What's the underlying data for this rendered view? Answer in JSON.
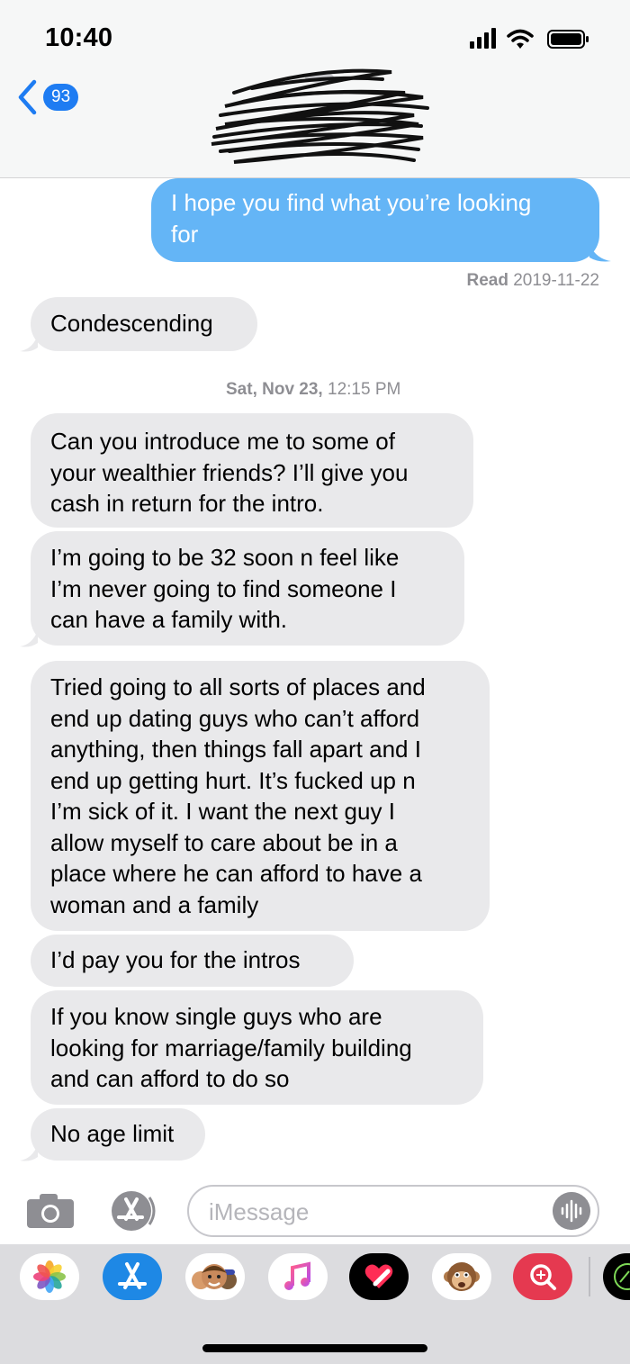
{
  "status_bar": {
    "time": "10:40"
  },
  "header": {
    "unread_count": "93"
  },
  "messages": [
    {
      "text": "I hope you find what you’re looking\nfor"
    },
    {
      "read_label": "Read",
      "read_date": "2019-11-22"
    },
    {
      "text": "Condescending"
    },
    {
      "day": "Sat, Nov 23,",
      "time": "12:15 PM"
    },
    {
      "text": "Can you introduce me to some of\nyour wealthier friends? I’ll give you\ncash in return for the intro."
    },
    {
      "text": "I’m going to be 32 soon n feel like\nI’m never going to find someone I\ncan have a family with."
    },
    {
      "text": "Tried going to all sorts of places and\nend up dating guys who can’t afford\nanything, then things fall apart and I\nend up getting hurt. It’s fucked up n\nI’m sick of it. I want the next guy I\nallow myself to care about be in a\nplace where he can afford to have a\nwoman and a family"
    },
    {
      "text": "I’d pay you for the intros"
    },
    {
      "text": "If you know single guys who are\nlooking for marriage/family building\nand can afford to do so"
    },
    {
      "text": "No age limit"
    }
  ],
  "composer": {
    "placeholder": "iMessage"
  },
  "icons": {
    "signal": "cellular-signal-icon",
    "wifi": "wifi-icon",
    "battery": "battery-icon",
    "back": "chevron-left-icon",
    "camera": "camera-icon",
    "apps": "app-store-icon",
    "audio": "audio-waveform-icon",
    "drawer": [
      "photos-icon",
      "app-store-icon",
      "memoji-icon",
      "music-icon",
      "digital-touch-icon",
      "animoji-icon",
      "image-search-icon",
      "fitness-icon"
    ]
  },
  "colors": {
    "outgoing": "#64b5f6",
    "incoming": "#e9e9eb",
    "accent": "#1e7cf2"
  }
}
